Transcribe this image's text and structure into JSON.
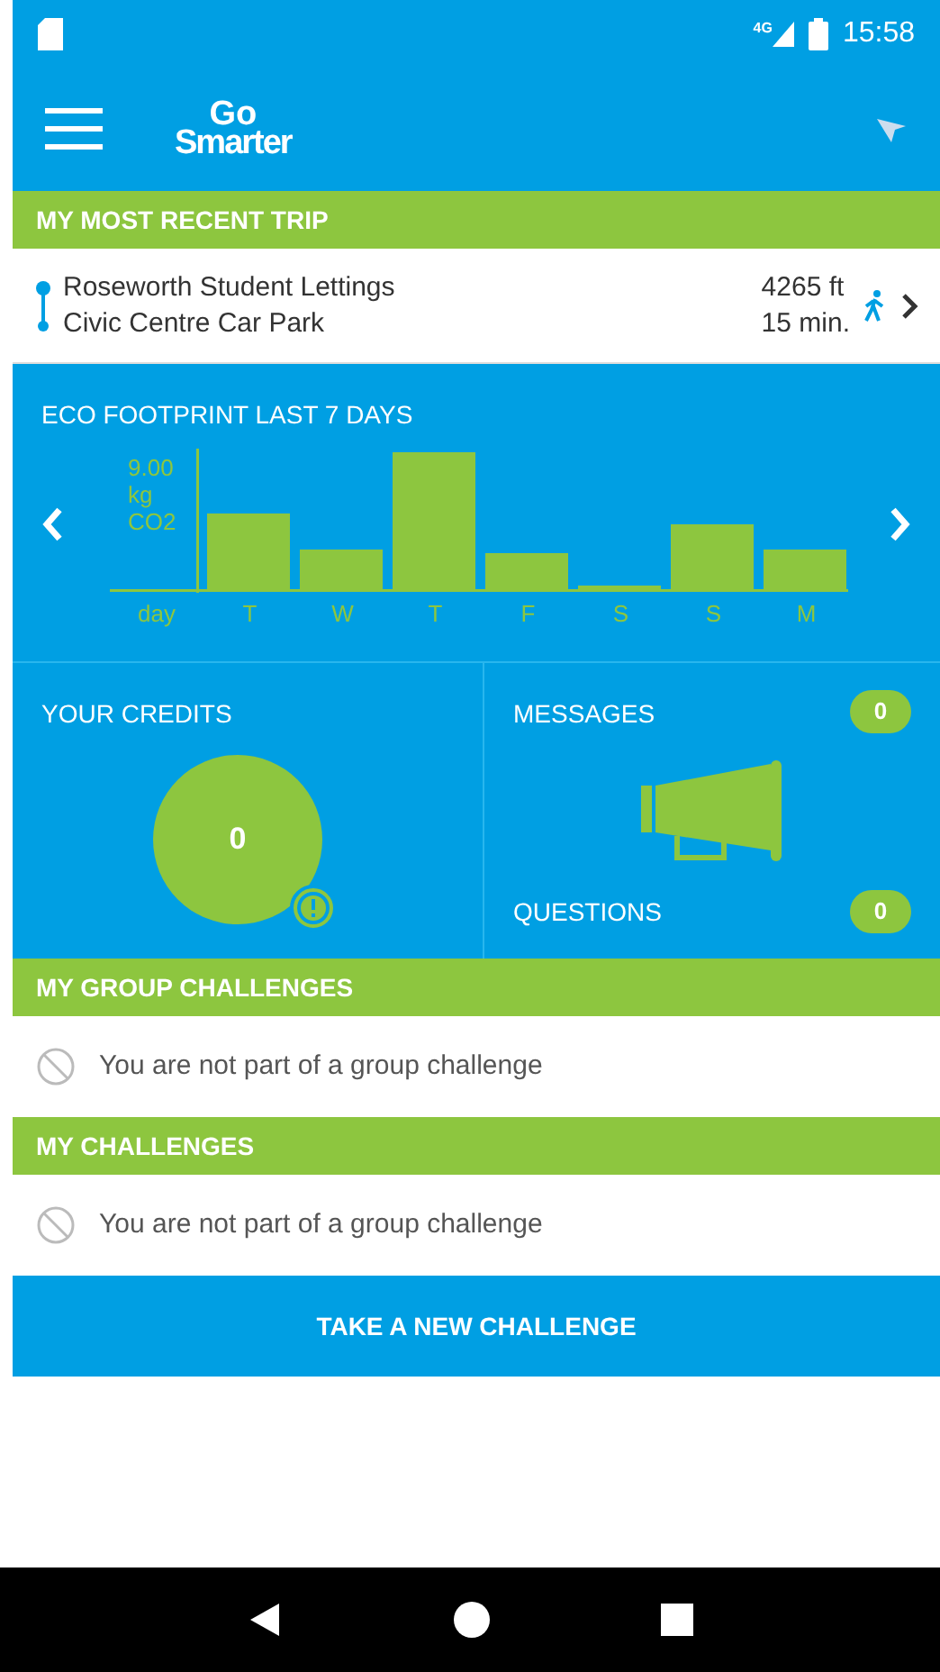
{
  "status_bar": {
    "network": "4G",
    "time": "15:58"
  },
  "app_bar": {
    "logo_top": "Go",
    "logo_bottom": "Smarter"
  },
  "recent_trip": {
    "header": "MY MOST RECENT TRIP",
    "from": "Roseworth Student Lettings",
    "to": "Civic Centre Car Park",
    "distance": "4265 ft",
    "duration": "15 min."
  },
  "eco": {
    "title": "ECO FOOTPRINT LAST 7 DAYS",
    "axis_label": [
      "9.00",
      "kg",
      "CO2"
    ],
    "x_label": "day",
    "days": [
      "T",
      "W",
      "T",
      "F",
      "S",
      "S",
      "M"
    ]
  },
  "credits": {
    "title": "YOUR CREDITS",
    "value": "0"
  },
  "messages": {
    "title": "MESSAGES",
    "count": "0"
  },
  "questions": {
    "title": "QUESTIONS",
    "count": "0"
  },
  "sections": [
    {
      "header": "MY GROUP CHALLENGES",
      "empty_text": "You are not part of a group challenge"
    },
    {
      "header": "MY CHALLENGES",
      "empty_text": "You are not part of a group challenge"
    }
  ],
  "action_button": "TAKE A NEW CHALLENGE"
}
